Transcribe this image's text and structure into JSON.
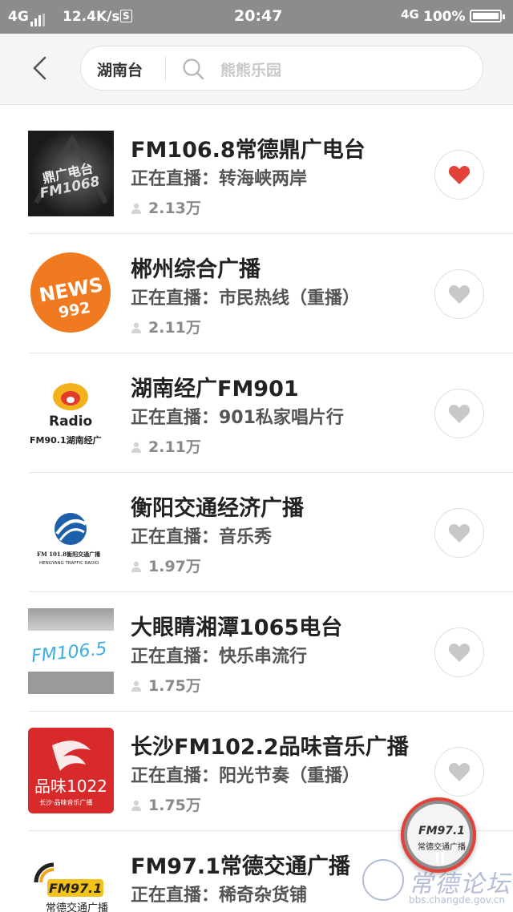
{
  "status": {
    "net_left": "4G",
    "speed": "12.4K/s",
    "s_badge": "S",
    "time": "20:47",
    "net_right": "4G",
    "battery": "100%"
  },
  "header": {
    "region": "湖南台",
    "search_placeholder": "熊熊乐园"
  },
  "live_prefix": "正在直播：",
  "stations": [
    {
      "title": "FM106.8常德鼎广电台",
      "program": "正在直播：转海峡两岸",
      "listeners": "2.13万",
      "favorited": true,
      "logo": "FM1068 鼎广电台"
    },
    {
      "title": "郴州综合广播",
      "program": "正在直播：市民热线（重播）",
      "listeners": "2.11万",
      "favorited": false,
      "logo": "NEWS 992"
    },
    {
      "title": "湖南经广FM901",
      "program": "正在直播：901私家唱片行",
      "listeners": "2.11万",
      "favorited": false,
      "logo": "Radio FM90.1湖南经广"
    },
    {
      "title": "衡阳交通经济广播",
      "program": "正在直播：音乐秀",
      "listeners": "1.97万",
      "favorited": false,
      "logo": "FM 101.8衡阳交通广播 HENGYANG TRAFFIC RADIO"
    },
    {
      "title": "大眼睛湘潭1065电台",
      "program": "正在直播：快乐串流行",
      "listeners": "1.75万",
      "favorited": false,
      "logo": "FM106.5"
    },
    {
      "title": "长沙FM102.2品味音乐广播",
      "program": "正在直播：阳光节奏（重播）",
      "listeners": "1.75万",
      "favorited": false,
      "logo": "品味1022 长沙·品味音乐广播"
    },
    {
      "title": "FM97.1常德交通广播",
      "program": "正在直播：稀奇杂货铺",
      "listeners": "",
      "favorited": false,
      "logo": "FM97.1 常德交通广播"
    }
  ],
  "player": {
    "logo_text": "FM97.1",
    "sub_text": "常德交通广播"
  },
  "watermark": {
    "text": "常德论坛",
    "url": "bbs.changde.gov.cn"
  },
  "colors": {
    "heart_active": "#e3423b",
    "heart_inactive": "#c8c8c8",
    "statusbar": "#8c8c8c"
  }
}
